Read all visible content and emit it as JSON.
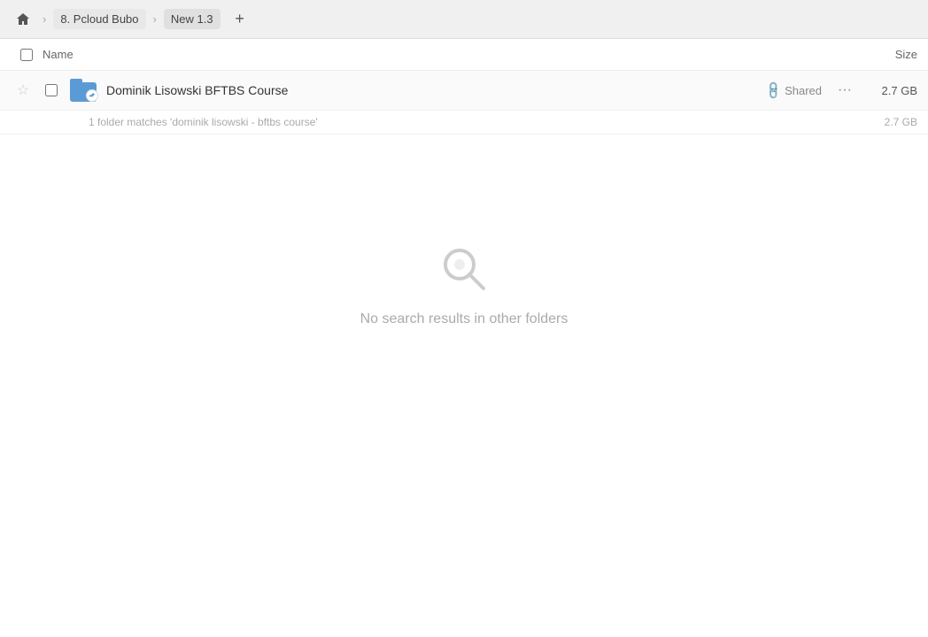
{
  "topbar": {
    "home_icon": "home",
    "breadcrumb_items": [
      {
        "label": "8. Pcloud Bubo",
        "active": false
      },
      {
        "label": "New 1.3",
        "active": true
      }
    ],
    "add_button_label": "+"
  },
  "table": {
    "name_header": "Name",
    "size_header": "Size",
    "rows": [
      {
        "name": "Dominik Lisowski BFTBS Course",
        "shared_label": "Shared",
        "size": "2.7 GB",
        "match_text": "1 folder matches 'dominik lisowski - bftbs course'",
        "match_size": "2.7 GB"
      }
    ]
  },
  "empty_state": {
    "text": "No search results in other folders"
  }
}
